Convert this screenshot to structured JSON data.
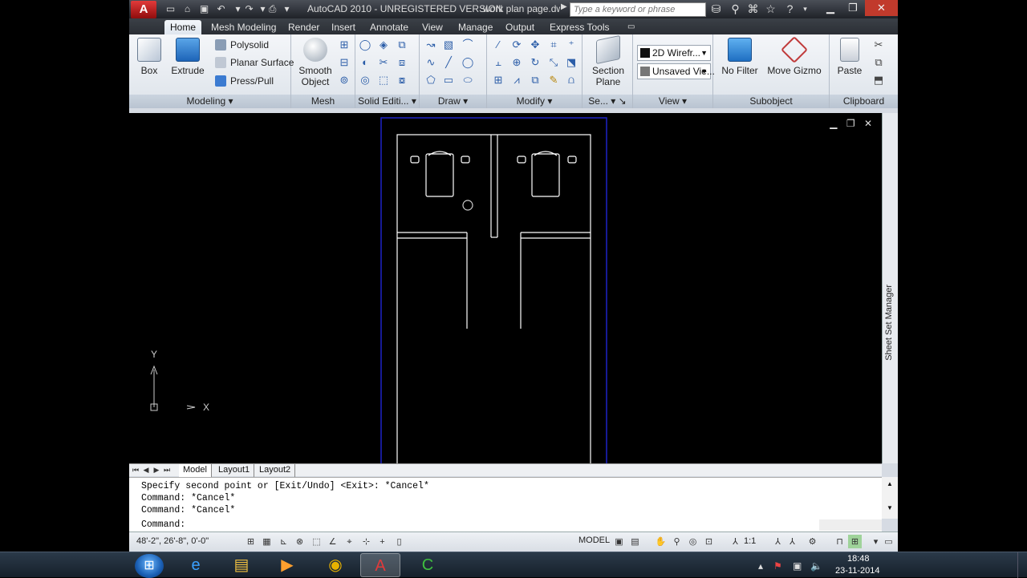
{
  "titlebar": {
    "app_title": "AutoCAD 2010 - UNREGISTERED VERSION",
    "doc_title": "work plan page.dwg",
    "search_placeholder": "Type a keyword or phrase"
  },
  "tabs": [
    {
      "label": "Home",
      "active": true
    },
    {
      "label": "Mesh Modeling"
    },
    {
      "label": "Render"
    },
    {
      "label": "Insert"
    },
    {
      "label": "Annotate"
    },
    {
      "label": "View"
    },
    {
      "label": "Manage"
    },
    {
      "label": "Output"
    },
    {
      "label": "Express Tools"
    }
  ],
  "ribbon": {
    "modeling": {
      "title": "Modeling",
      "box_label": "Box",
      "extrude_label": "Extrude",
      "polysolid_label": "Polysolid",
      "planar_surface_label": "Planar Surface",
      "press_pull_label": "Press/Pull"
    },
    "mesh": {
      "title": "Mesh",
      "smooth_label_1": "Smooth",
      "smooth_label_2": "Object"
    },
    "solid_editing": {
      "title": "Solid Editi..."
    },
    "draw": {
      "title": "Draw"
    },
    "modify": {
      "title": "Modify"
    },
    "section": {
      "title": "Se...",
      "plane_label_1": "Section",
      "plane_label_2": "Plane"
    },
    "view": {
      "title": "View",
      "visual_style": "2D Wirefr...",
      "saved_view": "Unsaved Vie..."
    },
    "subobject": {
      "title": "Subobject",
      "no_filter_label": "No Filter",
      "move_gizmo_label": "Move Gizmo"
    },
    "clipboard": {
      "title": "Clipboard",
      "paste_label": "Paste"
    }
  },
  "viewport": {
    "ucs_x": "X",
    "ucs_y": "Y",
    "sheet_set_manager": "Sheet Set Manager",
    "colors": {
      "background": "#000000",
      "border": "#1e22c8",
      "lines": "#ffffff"
    }
  },
  "layout_tabs": [
    {
      "label": "Model",
      "active": true
    },
    {
      "label": "Layout1"
    },
    {
      "label": "Layout2"
    }
  ],
  "command": {
    "line1": "Specify second point or [Exit/Undo] <Exit>: *Cancel*",
    "line2": "Command: *Cancel*",
    "line3": "Command: *Cancel*",
    "prompt": "Command:"
  },
  "statusbar": {
    "coords": "48'-2\", 26'-8\", 0'-0\"",
    "model": "MODEL",
    "scale": "1:1"
  },
  "taskbar": {
    "time": "18:48",
    "date": "23-11-2014"
  }
}
